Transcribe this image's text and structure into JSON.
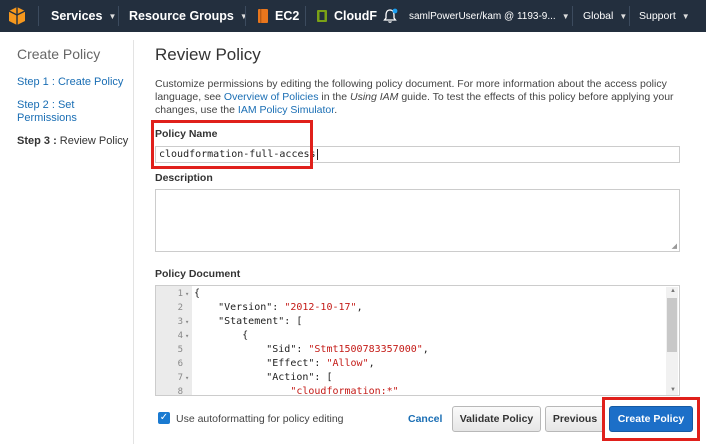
{
  "topbar": {
    "services": "Services",
    "resource_groups": "Resource Groups",
    "ec2": "EC2",
    "cloudformation": "CloudF",
    "account": "samlPowerUser/kam @ 1193-9...",
    "region": "Global",
    "support": "Support"
  },
  "sidebar": {
    "title": "Create Policy",
    "step1": "Step 1 : Create Policy",
    "step2_line1": "Step 2 : Set",
    "step2_line2": "Permissions",
    "step3_prefix": "Step 3 :",
    "step3_label": "Review Policy"
  },
  "main": {
    "title": "Review Policy",
    "intro_1": "Customize permissions by editing the following policy document. For more information about the access policy language,",
    "intro_2a": "see",
    "intro_link1": "Overview of Policies",
    "intro_2b": "in the",
    "intro_2c": "Using IAM",
    "intro_2d": "guide. To test the effects of this policy before applying your changes, use the",
    "intro_link2": "IAM Policy Simulator",
    "intro_end": ".",
    "policy_name_label": "Policy Name",
    "policy_name_value": "cloudformation-full-access",
    "description_label": "Description",
    "description_value": "",
    "policy_document_label": "Policy Document",
    "code": [
      {
        "n": "1",
        "fold": "▾",
        "pre": "{",
        "str": "",
        "post": ""
      },
      {
        "n": "2",
        "fold": "",
        "pre": "    \"Version\": ",
        "str": "\"2012-10-17\"",
        "post": ","
      },
      {
        "n": "3",
        "fold": "▾",
        "pre": "    \"Statement\": [",
        "str": "",
        "post": ""
      },
      {
        "n": "4",
        "fold": "▾",
        "pre": "        {",
        "str": "",
        "post": ""
      },
      {
        "n": "5",
        "fold": "",
        "pre": "            \"Sid\": ",
        "str": "\"Stmt1500783357000\"",
        "post": ","
      },
      {
        "n": "6",
        "fold": "",
        "pre": "            \"Effect\": ",
        "str": "\"Allow\"",
        "post": ","
      },
      {
        "n": "7",
        "fold": "▾",
        "pre": "            \"Action\": [",
        "str": "",
        "post": ""
      },
      {
        "n": "8",
        "fold": "",
        "pre": "                ",
        "str": "\"cloudformation:*\"",
        "post": ""
      }
    ],
    "autoformat_label": "Use autoformatting for policy editing"
  },
  "buttons": {
    "cancel": "Cancel",
    "validate": "Validate Policy",
    "previous": "Previous",
    "create": "Create Policy"
  },
  "colors": {
    "topbar": "#232f3e",
    "accent": "#1c6fc8",
    "highlight": "#e0201b",
    "link": "#1a6eb4"
  }
}
